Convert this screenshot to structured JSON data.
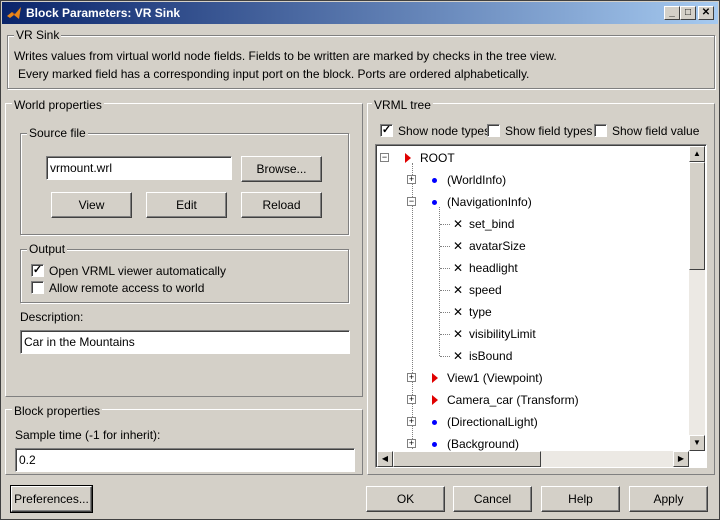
{
  "window": {
    "title": "Block Parameters: VR Sink"
  },
  "header": {
    "group_title": "VR Sink",
    "line1": "Writes values from virtual world node fields. Fields to be written are marked by checks in the tree view.",
    "line2": "Every marked field has a corresponding input port on the block. Ports are ordered alphabetically."
  },
  "world": {
    "title": "World properties",
    "source_title": "Source file",
    "source_value": "vrmount.wrl",
    "browse": "Browse...",
    "view": "View",
    "edit": "Edit",
    "reload": "Reload",
    "output_title": "Output",
    "open_viewer": {
      "label": "Open VRML viewer automatically",
      "checked": true
    },
    "remote_access": {
      "label": "Allow remote access to world",
      "checked": false
    },
    "description_label": "Description:",
    "description_value": "Car in the Mountains"
  },
  "block": {
    "title": "Block properties",
    "sample_label": "Sample time (-1 for inherit):",
    "sample_value": "0.2"
  },
  "vrml": {
    "title": "VRML tree",
    "show_node_types": {
      "label": "Show node types",
      "checked": true
    },
    "show_field_types": {
      "label": "Show field types",
      "checked": false
    },
    "show_field_value": {
      "label": "Show field value",
      "checked": false
    },
    "tree": [
      {
        "label": "ROOT",
        "icon": "red-triangle",
        "expander": "minus"
      },
      {
        "label": "(WorldInfo)",
        "icon": "blue-dot",
        "expander": "plus"
      },
      {
        "label": "(NavigationInfo)",
        "icon": "blue-dot",
        "expander": "minus"
      },
      {
        "label": "set_bind",
        "icon": "x-mark",
        "expander": "none"
      },
      {
        "label": "avatarSize",
        "icon": "x-mark",
        "expander": "none"
      },
      {
        "label": "headlight",
        "icon": "x-mark",
        "expander": "none"
      },
      {
        "label": "speed",
        "icon": "x-mark",
        "expander": "none"
      },
      {
        "label": "type",
        "icon": "x-mark",
        "expander": "none"
      },
      {
        "label": "visibilityLimit",
        "icon": "x-mark",
        "expander": "none"
      },
      {
        "label": "isBound",
        "icon": "x-mark",
        "expander": "none"
      },
      {
        "label": "View1 (Viewpoint)",
        "icon": "red-triangle",
        "expander": "plus"
      },
      {
        "label": "Camera_car (Transform)",
        "icon": "red-triangle",
        "expander": "plus"
      },
      {
        "label": "(DirectionalLight)",
        "icon": "blue-dot",
        "expander": "plus"
      },
      {
        "label": "(Background)",
        "icon": "blue-dot",
        "expander": "plus"
      }
    ]
  },
  "footer": {
    "preferences": "Preferences...",
    "ok": "OK",
    "cancel": "Cancel",
    "help": "Help",
    "apply": "Apply"
  }
}
